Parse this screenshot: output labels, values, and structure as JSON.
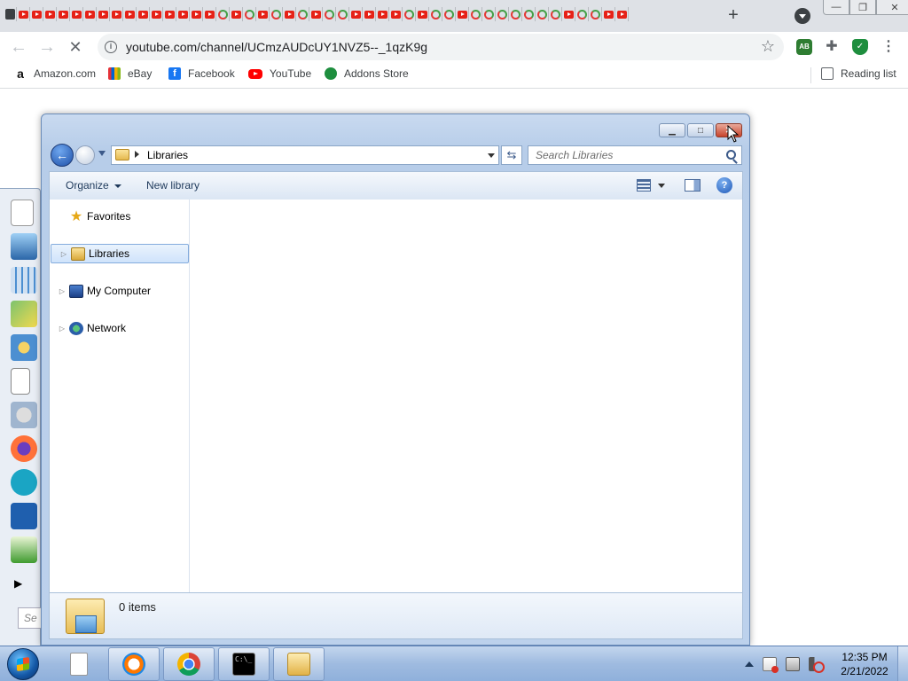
{
  "browser": {
    "tab_favicons": [
      "ext",
      "yt",
      "yt",
      "yt",
      "yt",
      "yt",
      "yt",
      "yt",
      "yt",
      "yt",
      "yt",
      "yt",
      "yt",
      "yt",
      "yt",
      "yt",
      "ring",
      "yt",
      "ring",
      "yt",
      "ring",
      "yt",
      "ring",
      "yt",
      "ring",
      "ring",
      "yt",
      "yt",
      "yt",
      "yt",
      "ring",
      "yt",
      "ring",
      "ring",
      "yt",
      "ring",
      "ring",
      "ring",
      "ring",
      "ring",
      "ring",
      "ring",
      "yt",
      "ring",
      "ring",
      "yt",
      "yt"
    ],
    "new_tab_label": "+",
    "omnibox": {
      "url": "youtube.com/channel/UCmzAUDcUY1NVZ5--_1qzK9g"
    },
    "extensions": [
      "adblock-icon",
      "puzzle-icon",
      "shield-icon",
      "menu-icon"
    ],
    "bookmarks": [
      {
        "label": "Amazon.com",
        "icon": "amazon-icon"
      },
      {
        "label": "eBay",
        "icon": "ebay-icon"
      },
      {
        "label": "Facebook",
        "icon": "facebook-icon"
      },
      {
        "label": "YouTube",
        "icon": "youtube-icon"
      },
      {
        "label": "Addons Store",
        "icon": "addons-icon"
      }
    ],
    "reading_list": "Reading list"
  },
  "explorer": {
    "breadcrumb": "Libraries",
    "search_placeholder": "Search Libraries",
    "commands": {
      "organize": "Organize",
      "new_library": "New library"
    },
    "nav": [
      {
        "label": "Favorites",
        "icon": "star-icon",
        "selected": false
      },
      {
        "label": "Libraries",
        "icon": "libraries-icon",
        "selected": true
      },
      {
        "label": "My Computer",
        "icon": "computer-icon",
        "selected": false
      },
      {
        "label": "Network",
        "icon": "network-icon",
        "selected": false
      }
    ],
    "details": {
      "item_count": "0 items"
    }
  },
  "sidepanel": {
    "search_hint": "Se"
  },
  "taskbar": {
    "clock_time": "12:35 PM",
    "clock_date": "2/21/2022"
  }
}
